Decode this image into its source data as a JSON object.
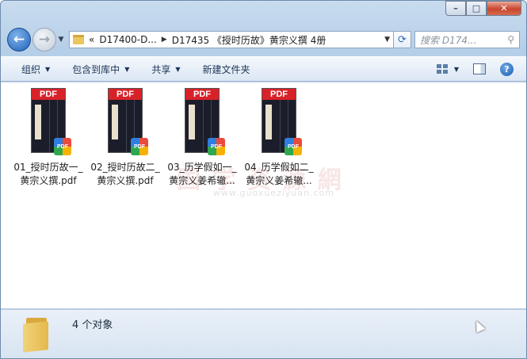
{
  "window": {
    "controls": {
      "minimize": "–",
      "maximize": "□",
      "close": "✕"
    }
  },
  "nav": {
    "back_glyph": "←",
    "forward_glyph": "→"
  },
  "address": {
    "crumb_prefix": "«",
    "crumb1": "D17400-D...",
    "crumb2": "D17435 《授时历故》黄宗义撰 4册",
    "refresh_glyph": "⟳"
  },
  "search": {
    "placeholder": "搜索 D174..."
  },
  "toolbar": {
    "organize": "组织",
    "include": "包含到库中",
    "share": "共享",
    "new_folder": "新建文件夹"
  },
  "files": [
    {
      "line1": "01_授时历故一_",
      "line2": "黄宗义撰.pdf"
    },
    {
      "line1": "02_授时历故二_",
      "line2": "黄宗义撰.pdf"
    },
    {
      "line1": "03_历学假如一_",
      "line2": "黄宗义姜希辙..."
    },
    {
      "line1": "04_历学假如二_",
      "line2": "黄宗义姜希辙..."
    }
  ],
  "thumb": {
    "label": "PDF",
    "badge": "PDF"
  },
  "watermark": {
    "text": "国 学 资 源 網",
    "url": "www.guoxueziyuan.com"
  },
  "status": {
    "count": "4 个对象"
  },
  "colors": {
    "accent": "#2060b8",
    "pdf_red": "#d8222a"
  }
}
